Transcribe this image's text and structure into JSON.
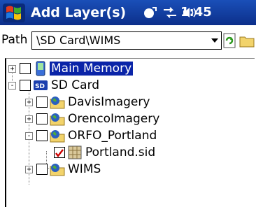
{
  "window": {
    "title": "Add Layer(s)",
    "clock": "1:45",
    "start_icon": "windows-flag-icon",
    "status_icons": [
      "sync-icon",
      "connectivity-icon",
      "volume-icon"
    ]
  },
  "path": {
    "label": "Path",
    "value": "\\SD Card\\WIMS"
  },
  "toolbar": {
    "icons": [
      "refresh-icon",
      "folder-icon"
    ]
  },
  "tree": {
    "items": [
      {
        "label": "Main Memory",
        "expander": "+",
        "checked": false,
        "icon": "device-icon",
        "selected": true
      },
      {
        "label": "SD Card",
        "expander": "-",
        "checked": false,
        "icon": "sd-card-icon",
        "selected": false
      },
      {
        "label": "DavisImagery",
        "expander": "+",
        "checked": false,
        "icon": "layer-folder-icon",
        "selected": false
      },
      {
        "label": "OrencoImagery",
        "expander": "+",
        "checked": false,
        "icon": "layer-folder-icon",
        "selected": false
      },
      {
        "label": "ORFO_Portland",
        "expander": "-",
        "checked": false,
        "icon": "layer-folder-icon",
        "selected": false
      },
      {
        "label": "Portland.sid",
        "expander": "",
        "checked": true,
        "icon": "raster-file-icon",
        "selected": false
      },
      {
        "label": "WIMS",
        "expander": "+",
        "checked": false,
        "icon": "layer-folder-icon",
        "selected": false
      }
    ]
  },
  "colors": {
    "titlebar": "#0c2f8a",
    "selection": "#0a24a8",
    "check_mark": "#cc0000"
  }
}
